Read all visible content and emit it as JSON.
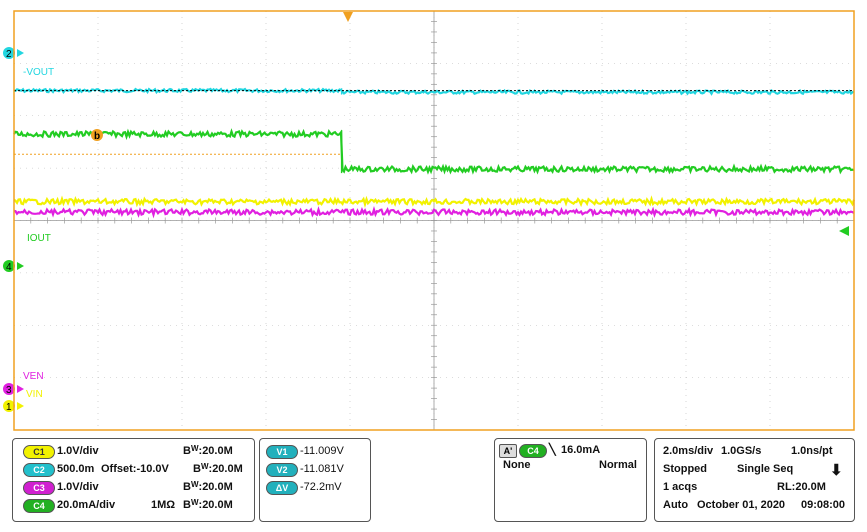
{
  "screen": {
    "trigger_marker_color": "#f0a020",
    "grid": {
      "divisions_x": 10,
      "divisions_y": 8
    }
  },
  "channels": [
    {
      "id": "C1",
      "badge": "C1",
      "color": "#f2f200",
      "marker_label": "1",
      "trace_label": "VIN",
      "scale": "1.0V/div",
      "offset": "",
      "coupling": "",
      "bandwidth": "20.0M"
    },
    {
      "id": "C2",
      "badge": "C2",
      "color": "#22d6e0",
      "marker_label": "2",
      "trace_label": "-VOUT",
      "scale": "500.0m",
      "offset": "Offset:-10.0V",
      "coupling": "",
      "bandwidth": "20.0M"
    },
    {
      "id": "C3",
      "badge": "C3",
      "color": "#e020e0",
      "marker_label": "3",
      "trace_label": "VEN",
      "scale": "1.0V/div",
      "offset": "",
      "coupling": "",
      "bandwidth": "20.0M"
    },
    {
      "id": "C4",
      "badge": "C4",
      "color": "#22cc22",
      "marker_label": "4",
      "trace_label": "IOUT",
      "scale": "20.0mA/div",
      "offset": "",
      "coupling": "1MΩ",
      "bandwidth": "20.0M"
    }
  ],
  "bandwidth_prefix": "B",
  "bandwidth_sub": "W",
  "measurements": [
    {
      "badge": "V1",
      "value": "-11.009V"
    },
    {
      "badge": "V2",
      "value": "-11.081V"
    },
    {
      "badge": "ΔV",
      "value": "-72.2mV"
    }
  ],
  "trigger": {
    "badge": "A'",
    "source": "C4",
    "edge_symbol": "╲",
    "level": "16.0mA",
    "coupling": "None",
    "mode": "Normal"
  },
  "acquisition": {
    "timebase": "2.0ms/div",
    "sample_rate": "1.0GS/s",
    "resolution": "1.0ns/pt",
    "state": "Stopped",
    "sequence": "Single Seq",
    "acqs": "1 acqs",
    "record_length": "RL:20.0M",
    "run_mode": "Auto",
    "date": "October 01, 2020",
    "time": "09:08:00"
  },
  "chart_data": {
    "type": "line",
    "title": "",
    "xlabel": "",
    "ylabel": "",
    "x_divisions": 10,
    "y_divisions": 8,
    "event_at_div": 3.9,
    "series": [
      {
        "name": "-VOUT",
        "channel": "C2",
        "level_div": [
          6.48,
          6.45
        ],
        "noise_div": 0.03
      },
      {
        "name": "IOUT",
        "channel": "C4",
        "level_div": [
          5.65,
          4.98
        ],
        "noise_div": 0.05
      },
      {
        "name": "VIN",
        "channel": "C1",
        "level_div": [
          4.36,
          4.36
        ],
        "noise_div": 0.05
      },
      {
        "name": "VEN",
        "channel": "C3",
        "level_div": [
          4.16,
          4.16
        ],
        "noise_div": 0.05
      }
    ]
  }
}
